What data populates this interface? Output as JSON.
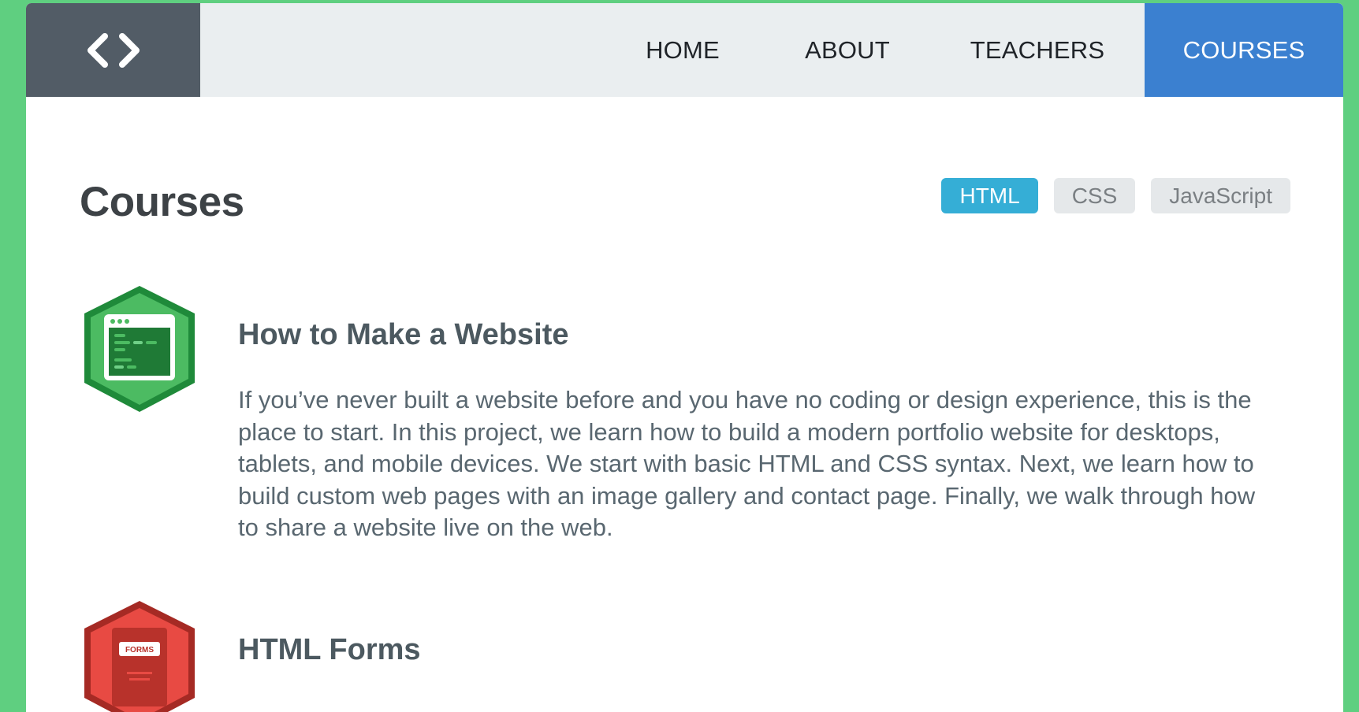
{
  "nav": {
    "logo_icon": "code-brackets-icon",
    "links": [
      "HOME",
      "ABOUT",
      "TEACHERS",
      "COURSES"
    ],
    "active": "COURSES"
  },
  "main": {
    "title": "Courses",
    "filters": [
      "HTML",
      "CSS",
      "JavaScript"
    ],
    "active_filter": "HTML"
  },
  "courses": [
    {
      "icon": "website-browser-badge-icon",
      "title": "How to Make a Website",
      "description": "If you’ve never built a website before and you have no coding or design experience, this is the place to start. In this project, we learn how to build a modern portfolio website for desktops, tablets, and mobile devices. We start with basic HTML and CSS syntax. Next, we learn how to build custom web pages with an image gallery and contact page. Finally, we walk through how to share a website live on the web."
    },
    {
      "icon": "forms-badge-icon",
      "badge_text": "FORMS",
      "title": "HTML Forms"
    }
  ],
  "colors": {
    "background": "#5fcf80",
    "nav_bg": "#eaeef0",
    "logo_bg": "#525c66",
    "active_nav": "#3b80d0",
    "active_filter": "#35aed6",
    "html_badge": "#4caf50",
    "forms_badge": "#e74c3c"
  }
}
